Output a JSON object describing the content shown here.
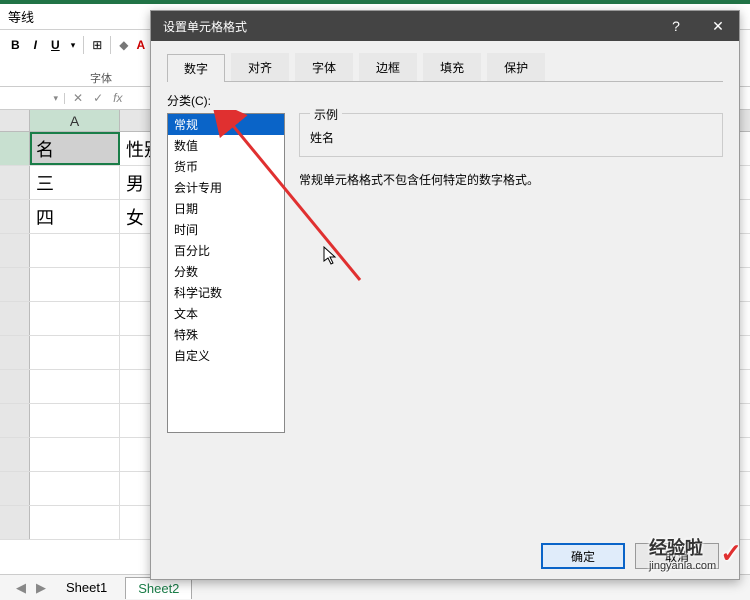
{
  "ribbon": {
    "section": "等线",
    "font_group": "字体"
  },
  "toolbar": {
    "bold": "B",
    "italic": "I",
    "underline": "U"
  },
  "namebox": {
    "value": ""
  },
  "fx": {
    "fx": "fx",
    "check": "✓",
    "cross": "✕",
    "dd": "▾"
  },
  "col": {
    "a": "A"
  },
  "cells": {
    "a1": "名",
    "b1": "性别",
    "a2": "三",
    "b2": "男",
    "a3": "四",
    "b3": "女"
  },
  "tabs": {
    "nav_l": "◀",
    "nav_r": "▶",
    "s1": "Sheet1",
    "s2": "Sheet2"
  },
  "dialog": {
    "title": "设置单元格格式",
    "help": "?",
    "close": "✕",
    "tabs": {
      "number": "数字",
      "align": "对齐",
      "font": "字体",
      "border": "边框",
      "fill": "填充",
      "protect": "保护"
    },
    "category_label": "分类(C):",
    "categories": [
      "常规",
      "数值",
      "货币",
      "会计专用",
      "日期",
      "时间",
      "百分比",
      "分数",
      "科学记数",
      "文本",
      "特殊",
      "自定义"
    ],
    "sample_label": "示例",
    "sample_value": "姓名",
    "description": "常规单元格格式不包含任何特定的数字格式。",
    "ok": "确定",
    "cancel": "取消"
  },
  "watermark": {
    "text": "经验啦",
    "sub": "jingyanla.com",
    "check": "✓"
  }
}
